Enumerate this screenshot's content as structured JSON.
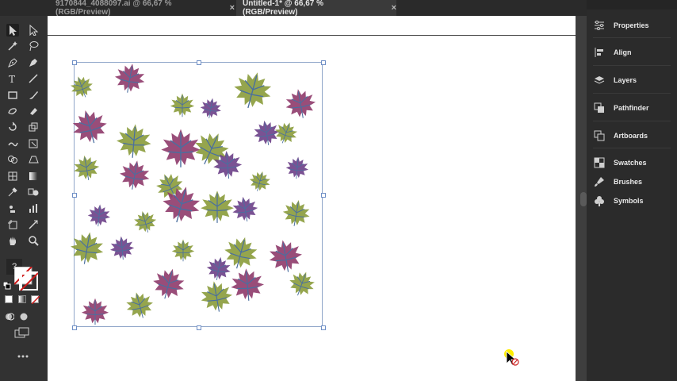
{
  "tabs": [
    {
      "label": "9170844_4088097.ai @ 66,67 % (RGB/Preview)",
      "active": false
    },
    {
      "label": "Untitled-1* @ 66,67 % (RGB/Preview)",
      "active": true
    }
  ],
  "tab_close_glyph": "×",
  "toolbar": {
    "tools": [
      "selection-tool",
      "direct-selection-tool",
      "magic-wand-tool",
      "lasso-tool",
      "pen-tool",
      "curvature-tool",
      "type-tool",
      "line-tool",
      "rectangle-tool",
      "paintbrush-tool",
      "shaper-tool",
      "eraser-tool",
      "rotate-tool",
      "scale-tool",
      "warp-tool",
      "free-transform-tool",
      "shape-builder-tool",
      "perspective-tool",
      "mesh-tool",
      "gradient-tool",
      "eyedropper-tool",
      "blend-tool",
      "symbol-sprayer-tool",
      "graph-tool",
      "artboard-tool",
      "slice-tool",
      "hand-tool",
      "zoom-tool"
    ],
    "question_label": "?"
  },
  "panel": {
    "items": [
      {
        "label": "Properties",
        "icon": "properties-icon"
      },
      {
        "label": "Align",
        "icon": "align-icon"
      },
      {
        "label": "Layers",
        "icon": "layers-icon"
      },
      {
        "label": "Pathfinder",
        "icon": "pathfinder-icon"
      },
      {
        "label": "Artboards",
        "icon": "artboards-icon"
      },
      {
        "label": "Swatches",
        "icon": "swatches-icon"
      },
      {
        "label": "Brushes",
        "icon": "brushes-icon"
      },
      {
        "label": "Symbols",
        "icon": "symbols-icon"
      }
    ]
  },
  "colors": {
    "leaf_purple": "#7e3f7a",
    "leaf_olive": "#8a9b3a",
    "leaf_magenta": "#8e3a6a",
    "leaf_violet": "#6c3f87",
    "leaf_vein": "#4a6f9f",
    "selection": "#6f8fc6"
  }
}
